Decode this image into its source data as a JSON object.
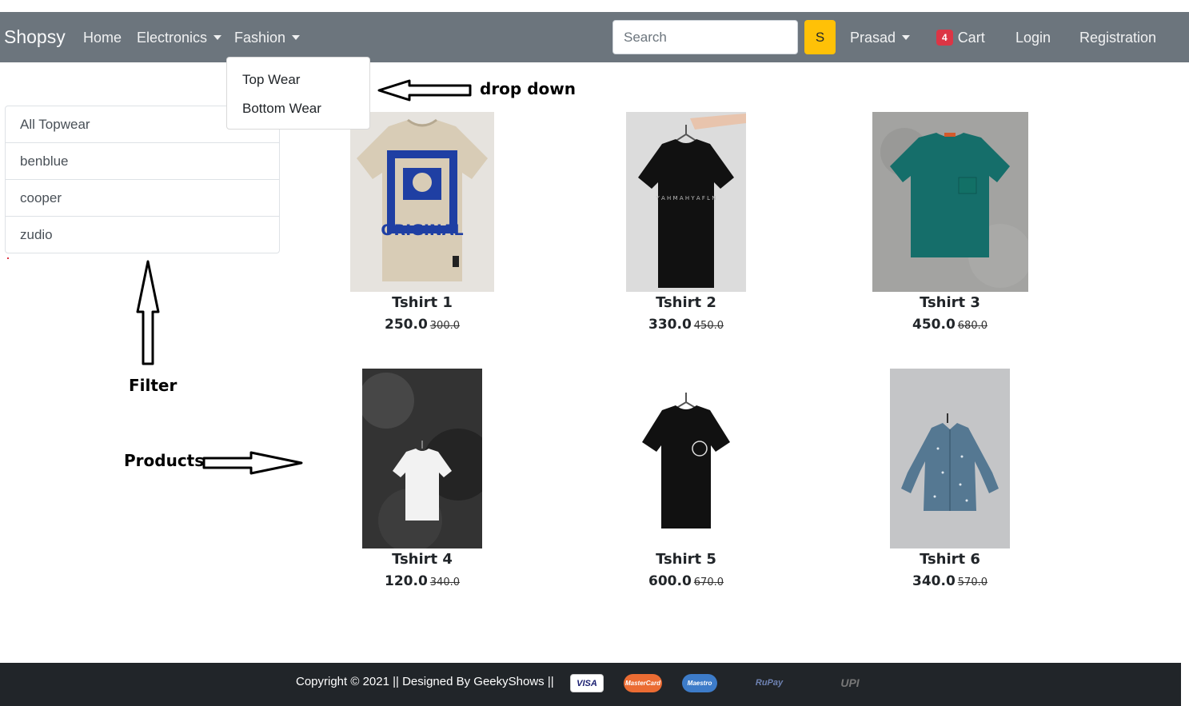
{
  "navbar": {
    "brand": "Shopsy",
    "home": "Home",
    "electronics": "Electronics",
    "fashion": "Fashion",
    "search_placeholder": "Search",
    "search_button": "S",
    "user": "Prasad",
    "cart_count": "4",
    "cart": "Cart",
    "login": "Login",
    "registration": "Registration"
  },
  "dropdown": {
    "items": [
      "Top Wear",
      "Bottom Wear"
    ]
  },
  "filter": {
    "items": [
      "All Topwear",
      "benblue",
      "cooper",
      "zudio"
    ]
  },
  "annotations": {
    "dropdown": "drop down",
    "filter": "Filter",
    "products": "Products"
  },
  "products": [
    {
      "name": "Tshirt 1",
      "price": "250.0",
      "old_price": "300.0"
    },
    {
      "name": "Tshirt 2",
      "price": "330.0",
      "old_price": "450.0"
    },
    {
      "name": "Tshirt 3",
      "price": "450.0",
      "old_price": "680.0"
    },
    {
      "name": "Tshirt 4",
      "price": "120.0",
      "old_price": "340.0"
    },
    {
      "name": "Tshirt 5",
      "price": "600.0",
      "old_price": "670.0"
    },
    {
      "name": "Tshirt 6",
      "price": "340.0",
      "old_price": "570.0"
    }
  ],
  "footer": {
    "text": "Copyright © 2021 || Designed By GeekyShows ||",
    "payments": [
      "VISA",
      "MasterCard",
      "Maestro",
      "RuPay",
      "UPI"
    ]
  },
  "colors": {
    "navbar": "#6c757d",
    "search_button": "#ffc107",
    "badge": "#dc3545",
    "footer": "#212529"
  }
}
